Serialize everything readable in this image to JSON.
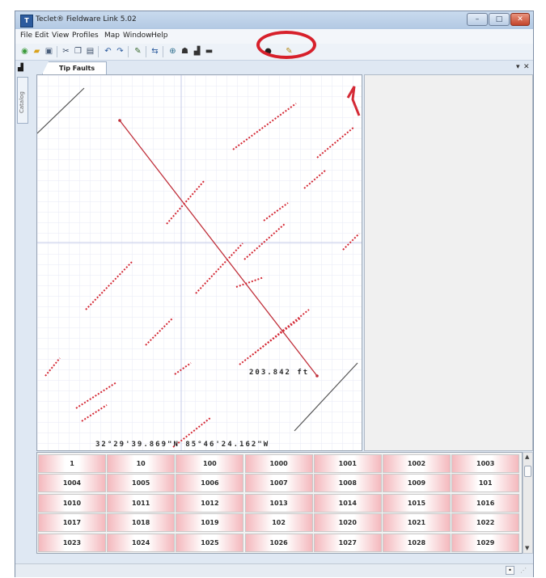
{
  "window": {
    "title": "Teclet® Fieldware Link 5.02",
    "icon": "app-logo-icon",
    "controls": {
      "minimize": "–",
      "maximize": "□",
      "close": "✕"
    }
  },
  "menu": [
    "File",
    "Edit",
    "View",
    "Profiles",
    "Map",
    "Window",
    "Help"
  ],
  "toolbar": {
    "buttons": [
      {
        "name": "new-icon",
        "glyph": "◉",
        "color": "#3a9a3a"
      },
      {
        "name": "open-folder-icon",
        "glyph": "▰",
        "color": "#d9a21b"
      },
      {
        "name": "save-icon",
        "glyph": "▣",
        "color": "#4a5f7c"
      },
      {
        "name": "cut-icon",
        "glyph": "✂",
        "color": "#3b4c66"
      },
      {
        "name": "copy-icon",
        "glyph": "❐",
        "color": "#3b4c66"
      },
      {
        "name": "paste-icon",
        "glyph": "▤",
        "color": "#3b4c66"
      },
      {
        "name": "undo-icon",
        "glyph": "↶",
        "color": "#2c5b9e"
      },
      {
        "name": "redo-icon",
        "glyph": "↷",
        "color": "#2c5b9e"
      },
      {
        "name": "edit-icon",
        "glyph": "✎",
        "color": "#3b6b2f"
      },
      {
        "name": "transfer-icon",
        "glyph": "⇆",
        "color": "#2c5b9e"
      },
      {
        "name": "globe-icon",
        "glyph": "⊕",
        "color": "#2d6d8c"
      },
      {
        "name": "user-icon",
        "glyph": "☗",
        "color": "#333333"
      },
      {
        "name": "chart-icon",
        "glyph": "▟",
        "color": "#333333"
      },
      {
        "name": "camera-icon",
        "glyph": "▬",
        "color": "#333333"
      },
      {
        "name": "record-icon",
        "glyph": "●",
        "color": "#1e1e1e"
      },
      {
        "name": "measure-ruler-icon",
        "glyph": "✎",
        "color": "#b58a1a"
      }
    ]
  },
  "document": {
    "tab_label": "Tip Faults",
    "tab_dropdown": "▾",
    "tab_close": "✕"
  },
  "sidebar": {
    "catalog_label": "Catalog"
  },
  "map": {
    "distance_label": "203.842 ft",
    "coordinate_label": "32°29'39.869\"N 85°46'24.162\"W"
  },
  "grid": {
    "rows": [
      [
        "1",
        "10",
        "100",
        "1000",
        "1001",
        "1002",
        "1003"
      ],
      [
        "1004",
        "1005",
        "1006",
        "1007",
        "1008",
        "1009",
        "101"
      ],
      [
        "1010",
        "1011",
        "1012",
        "1013",
        "1014",
        "1015",
        "1016"
      ],
      [
        "1017",
        "1018",
        "1019",
        "102",
        "1020",
        "1021",
        "1022"
      ],
      [
        "1023",
        "1024",
        "1025",
        "1026",
        "1027",
        "1028",
        "1029"
      ]
    ]
  },
  "colors": {
    "accent_red": "#d7202b",
    "fault_red": "#d42a36",
    "grid_line": "#dfe3f2"
  }
}
